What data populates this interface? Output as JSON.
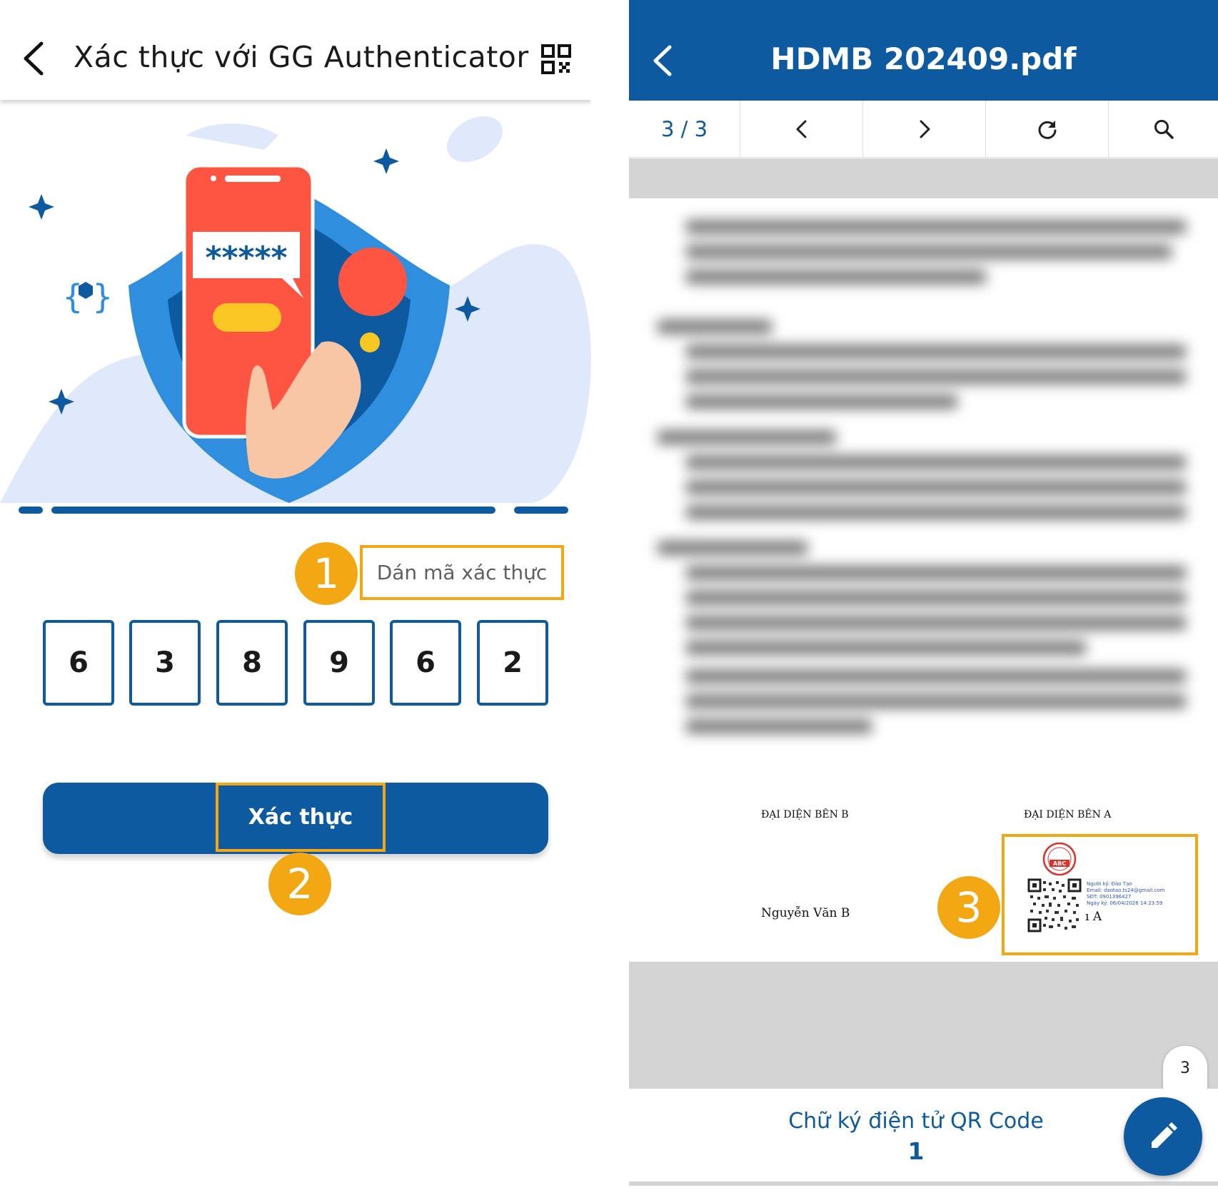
{
  "left": {
    "header": {
      "title": "Xác thực với GG Authenticator"
    },
    "illustration": {
      "masked_code": "*****"
    },
    "steps": {
      "one": "1",
      "two": "2",
      "three": "3"
    },
    "paste_label": "Dán mã xác thực",
    "otp_digits": [
      "6",
      "3",
      "8",
      "9",
      "6",
      "2"
    ],
    "verify_label": "Xác thực"
  },
  "right": {
    "header": {
      "title": "HDMB 202409.pdf"
    },
    "toolbar": {
      "page_indicator": "3 / 3"
    },
    "document": {
      "rep_b_label": "ĐẠI DIỆN BÊN B",
      "rep_a_label": "ĐẠI DIỆN BÊN A",
      "rep_b_name": "Nguyễn Văn B",
      "rep_a_name_fragment": "ı A",
      "stamp_text": "ABC",
      "signature": {
        "signer": "Người ký: Đào Tạo",
        "email": "Email: daotao.ts24@gmail.com",
        "phone": "SĐT: 0901396427",
        "date": "Ngày ký: 06/04/2026 14:23:59"
      }
    },
    "page_chip": "3",
    "bottom": {
      "title": "Chữ ký điện tử QR Code",
      "count": "1"
    }
  },
  "colors": {
    "primary": "#0e5aa0",
    "highlight": "#f3a712",
    "red": "#fe5543",
    "light_blob": "#dfe9fb"
  }
}
